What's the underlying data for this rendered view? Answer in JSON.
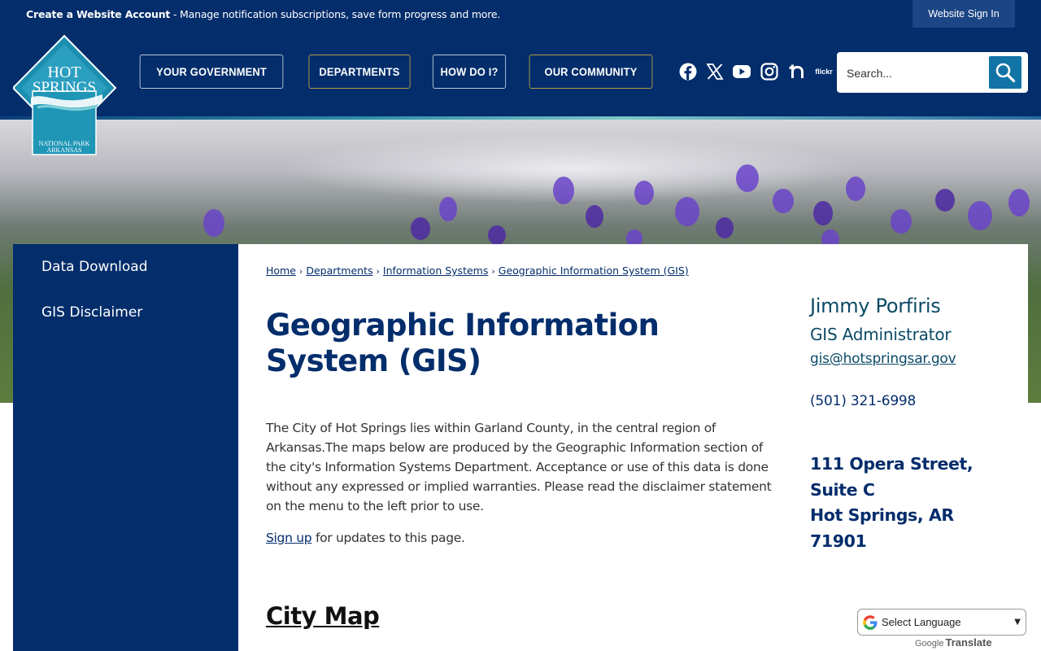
{
  "topbar": {
    "promo_bold": "Create a Website Account",
    "promo_text": " - Manage notification subscriptions, save form progress and more.",
    "signin_label": "Website Sign In"
  },
  "logo": {
    "line1": "HOT",
    "line2": "SPRINGS",
    "line3": "NATIONAL PARK",
    "line4": "ARKANSAS"
  },
  "nav": {
    "items": [
      {
        "label": "YOUR GOVERNMENT"
      },
      {
        "label": "DEPARTMENTS"
      },
      {
        "label": "HOW DO I?"
      },
      {
        "label": "OUR COMMUNITY"
      }
    ]
  },
  "social": {
    "icons": [
      "facebook-icon",
      "x-icon",
      "youtube-icon",
      "instagram-icon",
      "nextdoor-icon",
      "flickr-icon"
    ],
    "flickr_label": "flickr"
  },
  "search": {
    "placeholder": "Search..."
  },
  "sidebar": {
    "items": [
      {
        "label": "Data Download"
      },
      {
        "label": "GIS Disclaimer"
      }
    ]
  },
  "breadcrumb": {
    "items": [
      "Home",
      "Departments",
      "Information Systems",
      "Geographic Information System (GIS)"
    ],
    "separator": "›"
  },
  "main": {
    "title": "Geographic Information System (GIS)",
    "intro": "The City of Hot Springs lies within Garland County, in the central region of Arkansas.The maps below are produced by the Geographic Information section of the city's Information Systems Department. Acceptance or use of this data is done without any expressed or implied warranties. Please read the disclaimer statement on the menu to the left prior to use.",
    "signup_link": "Sign up",
    "signup_text": " for updates to this page.",
    "section_heading": "City Map"
  },
  "contact": {
    "name": "Jimmy Porfiris",
    "title": "GIS Administrator",
    "email": "gis@hotspringsar.gov",
    "phone": "(501) 321-6998",
    "address_line1": "111 Opera Street, Suite C",
    "address_line2": "Hot Springs, AR 71901"
  },
  "translate": {
    "label": "Select Language",
    "powered_by": "Google",
    "powered_suffix": "Translate"
  },
  "colors": {
    "brand_navy": "#032d6b",
    "accent_teal": "#1273a6",
    "contact_teal": "#0b4a66"
  }
}
